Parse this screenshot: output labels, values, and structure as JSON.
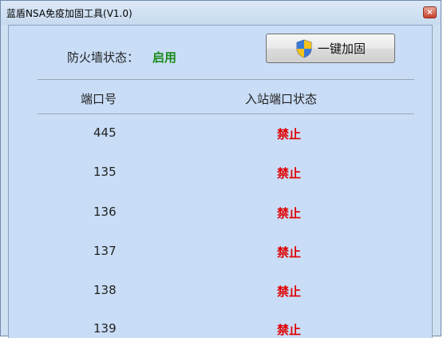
{
  "window": {
    "title": "蓝盾NSA免疫加固工具(V1.0)",
    "close_label": "×"
  },
  "firewall": {
    "label": "防火墙状态：",
    "value": "启用"
  },
  "harden_button": {
    "label": "一键加固",
    "icon": "uac-shield-icon"
  },
  "table": {
    "columns": [
      "端口号",
      "入站端口状态"
    ],
    "rows": [
      {
        "port": "445",
        "status": "禁止"
      },
      {
        "port": "135",
        "status": "禁止"
      },
      {
        "port": "136",
        "status": "禁止"
      },
      {
        "port": "137",
        "status": "禁止"
      },
      {
        "port": "138",
        "status": "禁止"
      },
      {
        "port": "139",
        "status": "禁止"
      }
    ]
  },
  "colors": {
    "enabled": "#1a8a1a",
    "blocked": "#e00000",
    "background": "#c9ddf7"
  }
}
